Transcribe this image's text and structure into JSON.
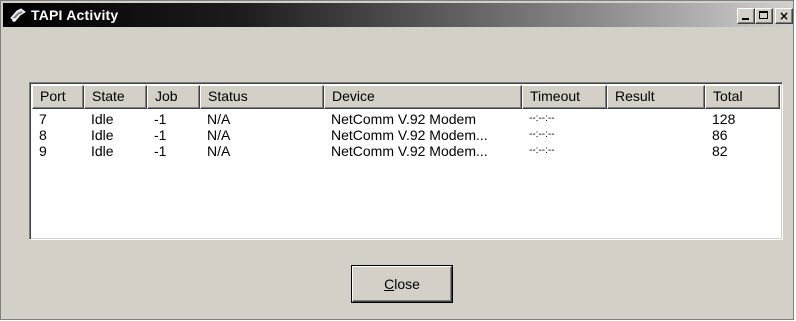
{
  "window": {
    "title": "TAPI Activity"
  },
  "caption_buttons": {
    "minimize": "minimize",
    "maximize": "maximize",
    "close": "×"
  },
  "table": {
    "columns": [
      "Port",
      "State",
      "Job",
      "Status",
      "Device",
      "Timeout",
      "Result",
      "Total"
    ],
    "rows": [
      {
        "port": "7",
        "state": "Idle",
        "job": "-1",
        "status": "N/A",
        "device": "NetComm V.92 Modem",
        "timeout": "--:--:--",
        "result": "",
        "total": "128"
      },
      {
        "port": "8",
        "state": "Idle",
        "job": "-1",
        "status": "N/A",
        "device": "NetComm V.92 Modem...",
        "timeout": "--:--:--",
        "result": "",
        "total": "86"
      },
      {
        "port": "9",
        "state": "Idle",
        "job": "-1",
        "status": "N/A",
        "device": "NetComm V.92 Modem...",
        "timeout": "--:--:--",
        "result": "",
        "total": "82"
      }
    ]
  },
  "buttons": {
    "close_label_mnemonic": "C",
    "close_label_rest": "lose"
  },
  "icons": {
    "title": "telephone-icon"
  }
}
